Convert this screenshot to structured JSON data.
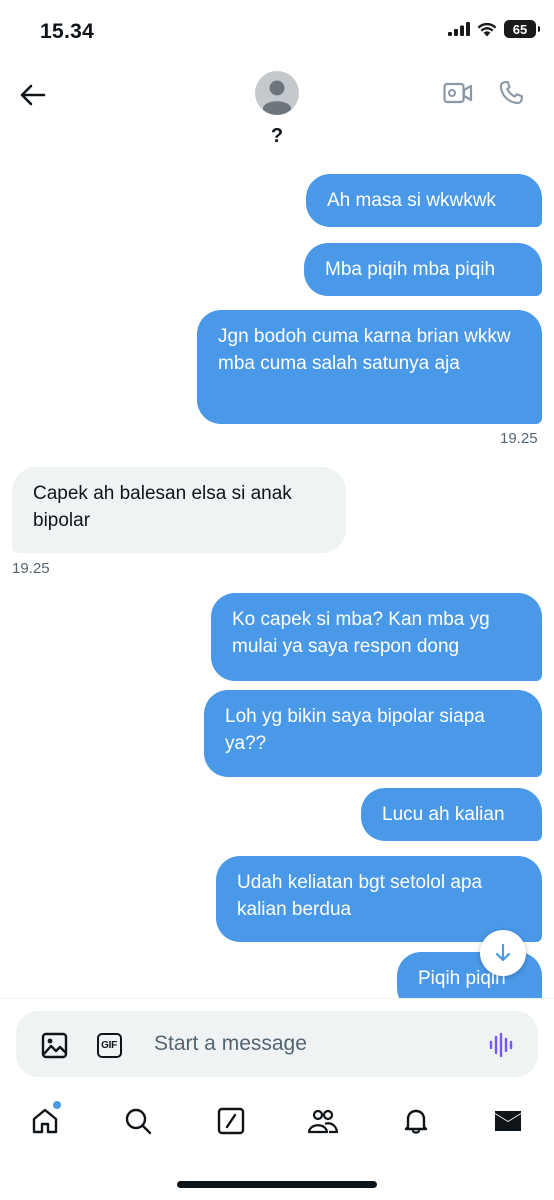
{
  "status_bar": {
    "time": "15.34",
    "battery": "65"
  },
  "header": {
    "contact_name": "?",
    "back_icon": "arrow-left-icon",
    "video_icon": "video-camera-icon",
    "call_icon": "phone-icon"
  },
  "messages": [
    {
      "direction": "sent",
      "text": "Ah masa si wkwkwk"
    },
    {
      "direction": "sent",
      "text": "Mba piqih mba piqih"
    },
    {
      "direction": "sent",
      "text": "Jgn bodoh cuma karna brian wkkw mba cuma salah satunya aja",
      "timestamp": "19.25"
    },
    {
      "direction": "received",
      "text": "Capek ah balesan elsa si anak bipolar",
      "timestamp": "19.25"
    },
    {
      "direction": "sent",
      "text": "Ko capek si mba? Kan mba yg mulai ya saya respon dong"
    },
    {
      "direction": "sent",
      "text": "Loh yg bikin saya bipolar siapa ya??"
    },
    {
      "direction": "sent",
      "text": "Lucu ah kalian"
    },
    {
      "direction": "sent",
      "text": "Udah keliatan bgt setolol apa kalian berdua"
    },
    {
      "direction": "sent",
      "text": "Piqih piqih"
    }
  ],
  "composer": {
    "placeholder": "Start a message",
    "gif_label": "GIF"
  },
  "tabbar": {
    "items": [
      "home-icon",
      "search-icon",
      "grok-icon",
      "communities-icon",
      "notifications-icon",
      "messages-icon"
    ]
  },
  "colors": {
    "sent_bubble": "#4a99e9",
    "received_bubble": "#eff3f4",
    "voice_accent": "#7856ff"
  }
}
